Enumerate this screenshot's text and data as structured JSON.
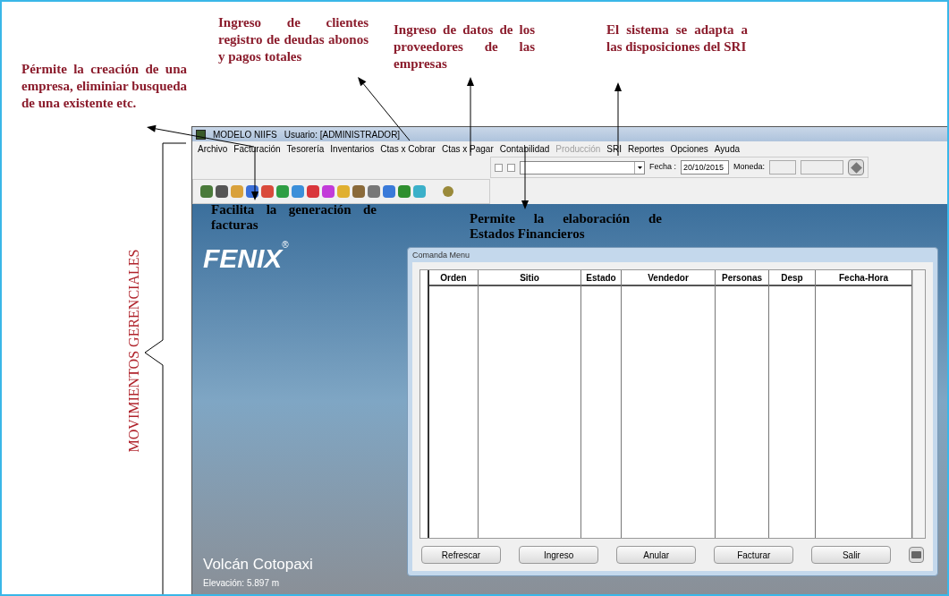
{
  "annotations": [
    {
      "kind": "note",
      "text": "Pérmite la creación de una empresa, eliminiar busqueda de una existente etc."
    },
    {
      "kind": "note",
      "text": "Ingreso de clientes registro de deudas abonos y pagos totales"
    },
    {
      "kind": "note",
      "text": "Ingreso de datos de los proveedores de las empresas"
    },
    {
      "kind": "note",
      "text": "El sistema se adapta a las disposiciones del SRI"
    },
    {
      "kind": "label",
      "text": "Facilita la generación de facturas"
    },
    {
      "kind": "label",
      "text": "Permite la elaboración de Estados Financieros"
    }
  ],
  "side_label": "MOVIMIENTOS GERENCIALES",
  "app": {
    "title": "MODELO NIIFS",
    "user": "Usuario: [ADMINISTRADOR]",
    "menu": [
      {
        "label": "Archivo",
        "disabled": false
      },
      {
        "label": "Facturación",
        "disabled": false
      },
      {
        "label": "Tesorería",
        "disabled": false
      },
      {
        "label": "Inventarios",
        "disabled": false
      },
      {
        "label": "Ctas x Cobrar",
        "disabled": false
      },
      {
        "label": "Ctas x Pagar",
        "disabled": false
      },
      {
        "label": "Contabilidad",
        "disabled": false
      },
      {
        "label": "Producción",
        "disabled": true
      },
      {
        "label": "SRI",
        "disabled": false
      },
      {
        "label": "Reportes",
        "disabled": false
      },
      {
        "label": "Opciones",
        "disabled": false
      },
      {
        "label": "Ayuda",
        "disabled": false
      }
    ],
    "toolbar": {
      "checkboxes": [
        {
          "checked": false
        },
        {
          "checked": false
        }
      ],
      "fecha_label": "Fecha :",
      "fecha": "20/10/2015",
      "moneda_label": "Moneda:"
    },
    "background": {
      "logo": "FENIX",
      "logo_mark": "®",
      "caption": "Volcán Cotopaxi",
      "subcaption": "Elevación: 5.897 m"
    },
    "dialog": {
      "title": "Comanda Menu",
      "columns": [
        "Orden",
        "Sitio",
        "Estado",
        "Vendedor",
        "Personas",
        "Desp",
        "Fecha-Hora"
      ],
      "buttons": [
        "Refrescar",
        "Ingreso",
        "Anular",
        "Facturar",
        "Salir"
      ]
    }
  }
}
